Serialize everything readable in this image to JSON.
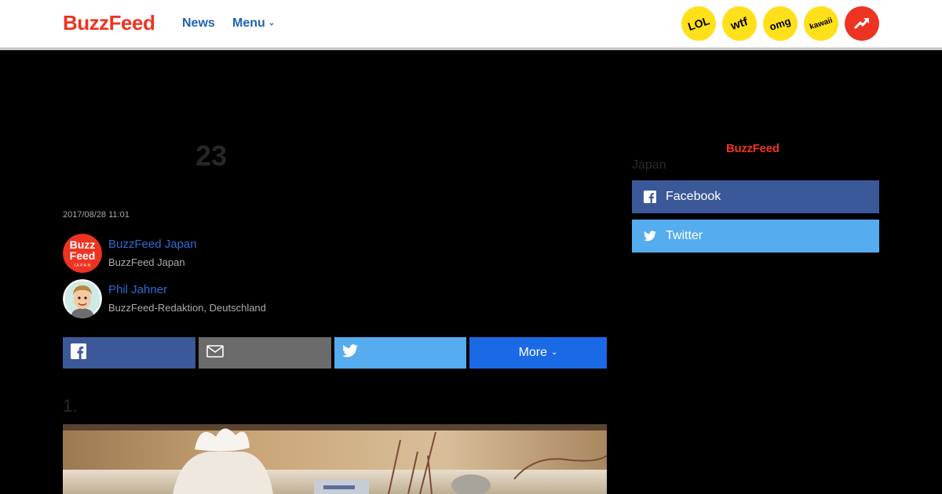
{
  "header": {
    "logo": "BuzzFeed",
    "nav": {
      "news": "News",
      "menu": "Menu"
    },
    "badges": [
      {
        "label": "LOL"
      },
      {
        "label": "wtf"
      },
      {
        "label": "omg"
      },
      {
        "label": "kawaii"
      }
    ],
    "colors": {
      "brand": "#ee3322",
      "link": "#1f63b5",
      "badge": "#ffe01a"
    }
  },
  "article": {
    "title_fragment": "23",
    "date": "2017/08/28 11:01",
    "authors": [
      {
        "name": "BuzzFeed Japan",
        "role": "BuzzFeed Japan",
        "avatar_text": [
          "Buzz",
          "Feed",
          "JAPAN"
        ]
      },
      {
        "name": "Phil Jahner",
        "role": "BuzzFeed-Redaktion, Deutschland"
      }
    ],
    "share": {
      "more_label": "More"
    },
    "item_number": "1."
  },
  "sidebar": {
    "logo": "BuzzFeed",
    "region": "Japan",
    "buttons": [
      {
        "label": "Facebook"
      },
      {
        "label": "Twitter"
      }
    ]
  }
}
